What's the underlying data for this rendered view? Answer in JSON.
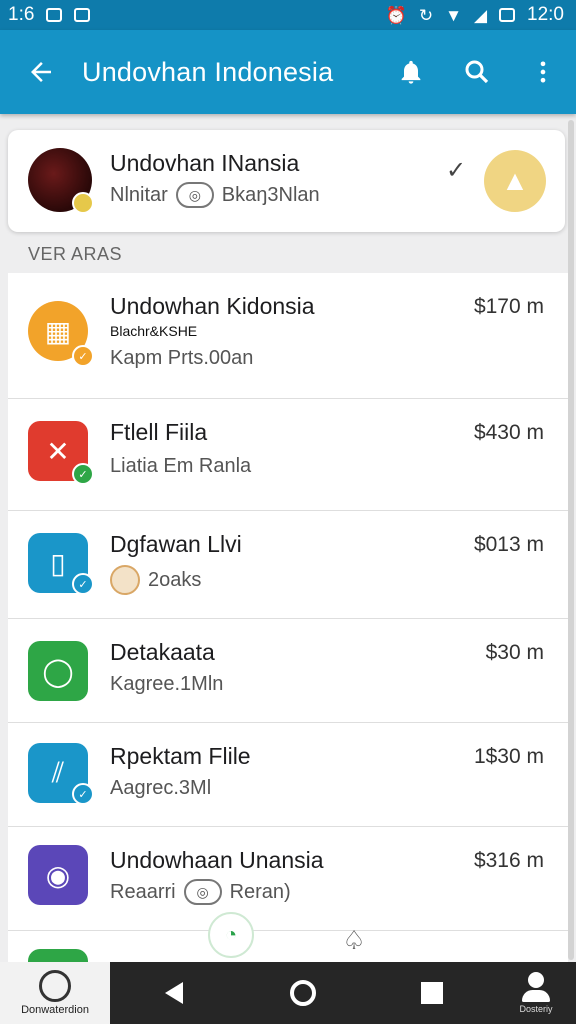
{
  "status_bar": {
    "time_left": "1:6",
    "time_right": "12:0",
    "icons": [
      "gallery-icon",
      "cast-icon",
      "alarm-icon",
      "sync-icon",
      "wifi-icon",
      "signal-icon",
      "battery-icon"
    ]
  },
  "app_bar": {
    "title": "Undovhan Indonesia",
    "back_icon": "arrow-left-icon",
    "actions": [
      "bell-icon",
      "search-icon",
      "more-vert-icon"
    ]
  },
  "account": {
    "name": "Undovhan INansia",
    "sub_left": "Nlnitar",
    "sub_right": "Bkaŋ3Nlan",
    "check_icon": "check-icon",
    "fab_icon": "person-icon",
    "accent": "#f0d583"
  },
  "section": {
    "label": "VER ARAS"
  },
  "rows": [
    {
      "title": "Undowhan Kidonsia",
      "note": "Blachr&KSHE",
      "sub": "Kapm Prts.00an",
      "amount": "$170 m",
      "icon": "store-icon",
      "color": "#f2a32a"
    },
    {
      "title": "Ftlell Fiila",
      "sub": "Liatia Em Ranla",
      "amount": "$430 m",
      "icon": "puzzle-icon",
      "color": "#e03b2e"
    },
    {
      "title": "Dgfawan Llvi",
      "sub": "2oaks",
      "amount": "$013 m",
      "icon": "document-icon",
      "color": "#1a96c9"
    },
    {
      "title": "Detakaata",
      "sub": "Kagree.1Mln",
      "amount": "$30 m",
      "icon": "search-icon",
      "color": "#2ea646"
    },
    {
      "title": "Rpektam Flile",
      "sub": "Aagrec.3Ml",
      "amount": "1$30 m",
      "icon": "slash-icon",
      "color": "#1a96c9"
    },
    {
      "title": "Undowhaan Unansia",
      "sub_left": "Reaarri",
      "sub_right": "Reran)",
      "amount": "$316 m",
      "icon": "camera-icon",
      "color": "#5b47b8"
    }
  ],
  "nav": {
    "profile_caption": "Donwaterdion",
    "user_caption": "Dosteriy",
    "back_icon": "nav-back-icon",
    "home_icon": "nav-home-icon",
    "recents_icon": "nav-recents-icon"
  }
}
